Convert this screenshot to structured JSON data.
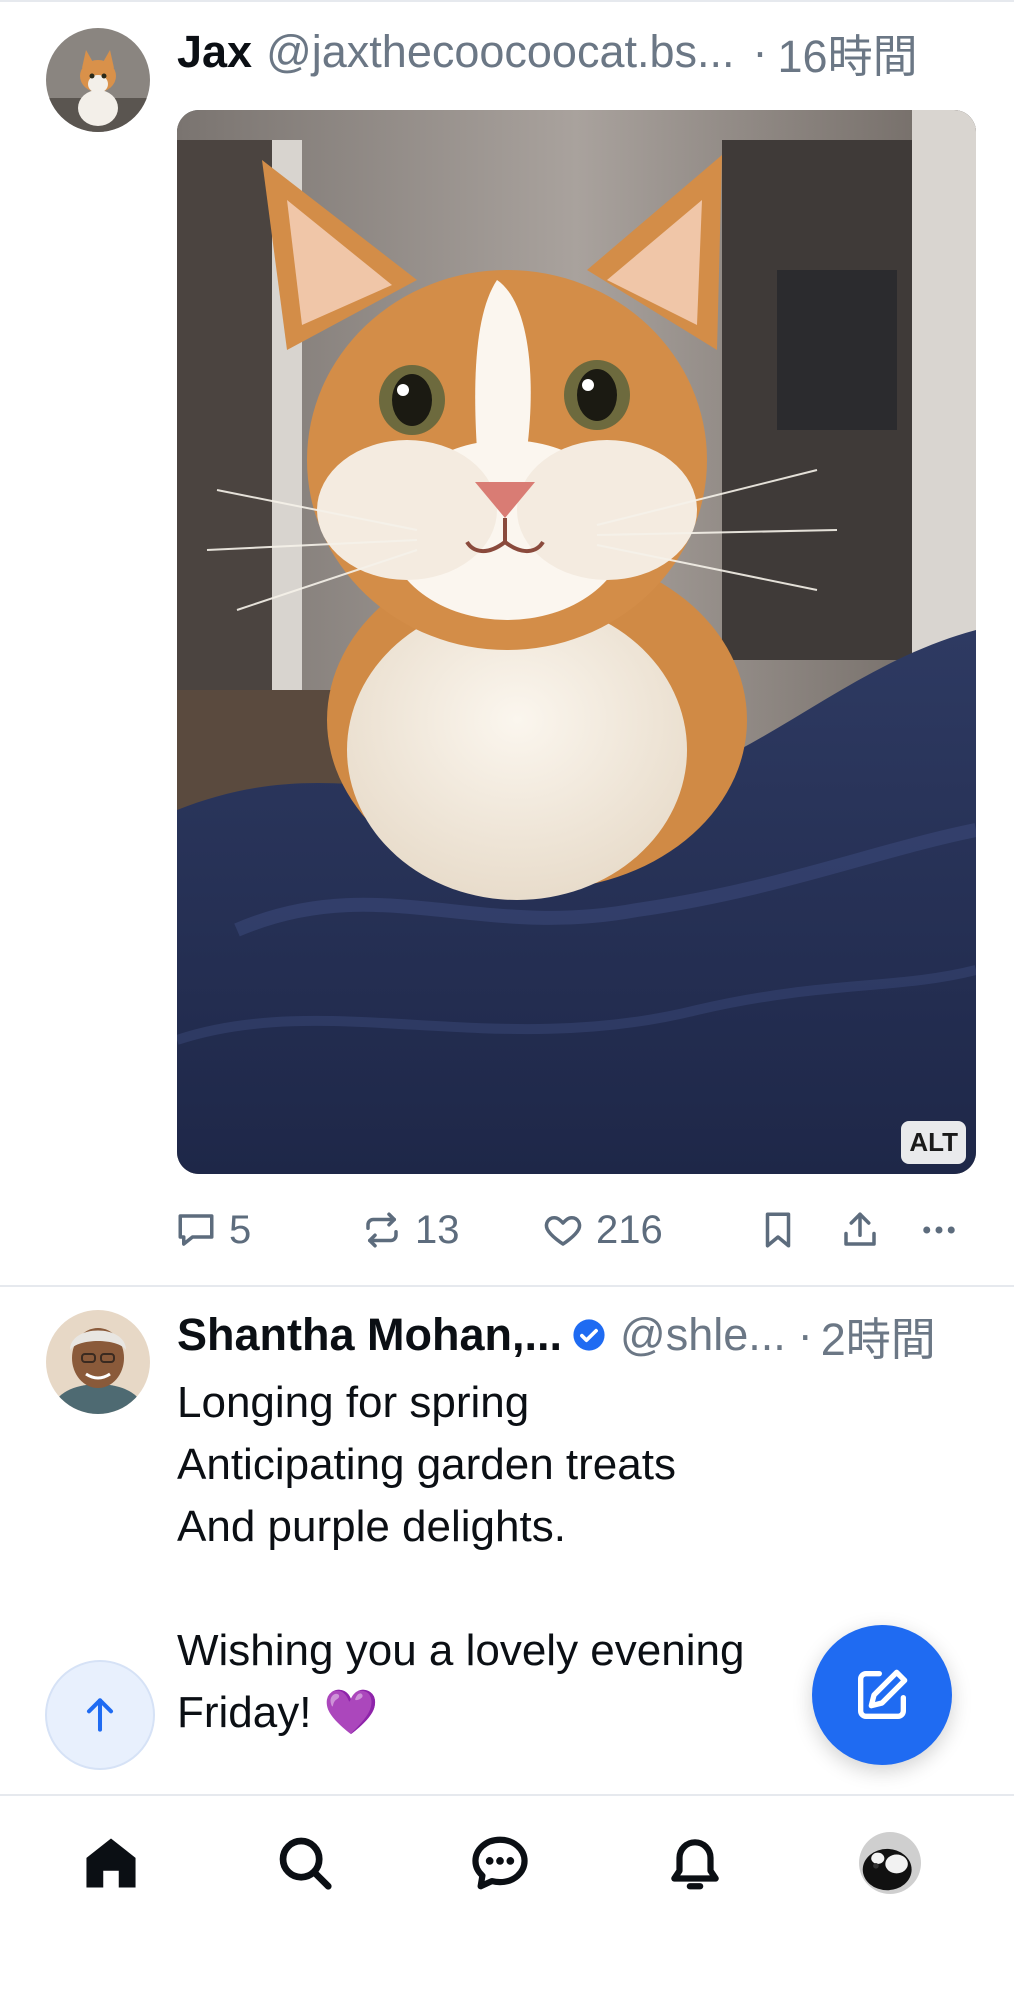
{
  "posts": [
    {
      "author": "Jax",
      "handle": "@jaxthecoocoocat.bs...",
      "separator": "·",
      "time": "16時間",
      "media_alt_badge": "ALT",
      "counts": {
        "replies": "5",
        "reposts": "13",
        "likes": "216"
      }
    },
    {
      "author": "Shantha Mohan,...",
      "verified": true,
      "handle": "@shle...",
      "separator": "·",
      "time": "2時間",
      "text": "Longing for spring\nAnticipating garden treats\nAnd purple delights.\n\nWishing you a lovely evening\nFriday! 💜"
    }
  ],
  "colors": {
    "accent": "#1f6bf2",
    "muted": "#6b7785",
    "verified": "#1f6bf2"
  },
  "nav": [
    "home-icon",
    "search-icon",
    "chat-icon",
    "bell-icon",
    "profile-avatar"
  ]
}
